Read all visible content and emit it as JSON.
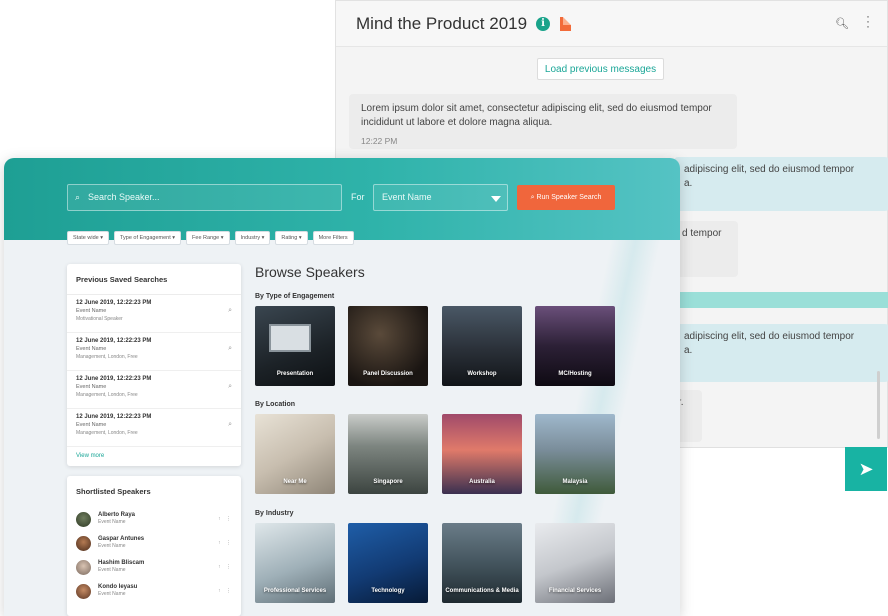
{
  "chat": {
    "title": "Mind the Product 2019",
    "info_icon": "info-circle-icon",
    "file_icon": "document-icon",
    "load_previous_label": "Load previous messages",
    "messages": [
      {
        "text": "Lorem ipsum dolor sit amet, consectetur adipiscing elit, sed do eiusmod tempor incididunt ut labore et dolore magna aliqua.",
        "time": "12:22 PM"
      }
    ],
    "partial_messages": [
      {
        "line1": "adipiscing elit, sed do eiusmod tempor",
        "line2": "a."
      },
      {
        "line1": "d tempor",
        "line2": ""
      },
      {
        "line1": "adipiscing elit, sed do eiusmod tempor",
        "line2": "a."
      },
      {
        "line1": "r.",
        "line2": ""
      }
    ],
    "send_icon": "send-icon"
  },
  "speakers": {
    "search_placeholder": "Search Speaker...",
    "for_label": "For",
    "event_select_value": "Event Name",
    "run_button_label": "Run Speaker Search",
    "filters": [
      "State wide ▾",
      "Type of Engagement ▾",
      "Fee Range ▾",
      "Industry ▾",
      "Rating ▾",
      "More Filters"
    ],
    "saved": {
      "title": "Previous Saved Searches",
      "items": [
        {
          "date": "12 June 2019, 12:22:23 PM",
          "event": "Event Name",
          "tags": "Motivational Speaker"
        },
        {
          "date": "12 June 2019, 12:22:23 PM",
          "event": "Event Name",
          "tags": "Management, London, Free"
        },
        {
          "date": "12 June 2019, 12:22:23 PM",
          "event": "Event Name",
          "tags": "Management, London, Free"
        },
        {
          "date": "12 June 2019, 12:22:23 PM",
          "event": "Event Name",
          "tags": "Management, London, Free"
        }
      ],
      "view_more": "View more"
    },
    "shortlist": {
      "title": "Shortlisted Speakers",
      "items": [
        {
          "name": "Alberto Raya",
          "event": "Event Name"
        },
        {
          "name": "Gaspar Antunes",
          "event": "Event Name"
        },
        {
          "name": "Hashim Bliscam",
          "event": "Event Name"
        },
        {
          "name": "Kondo Ieyasu",
          "event": "Event Name"
        }
      ]
    },
    "browse": {
      "title": "Browse Speakers",
      "sections": [
        {
          "label": "By Type of Engagement",
          "tiles": [
            "Presentation",
            "Panel Discussion",
            "Workshop",
            "MC/Hosting"
          ]
        },
        {
          "label": "By Location",
          "tiles": [
            "Near Me",
            "Singapore",
            "Australia",
            "Malaysia"
          ]
        },
        {
          "label": "By Industry",
          "tiles": [
            "Professional Services",
            "Technology",
            "Communications & Media",
            "Financial Services"
          ]
        }
      ]
    }
  }
}
